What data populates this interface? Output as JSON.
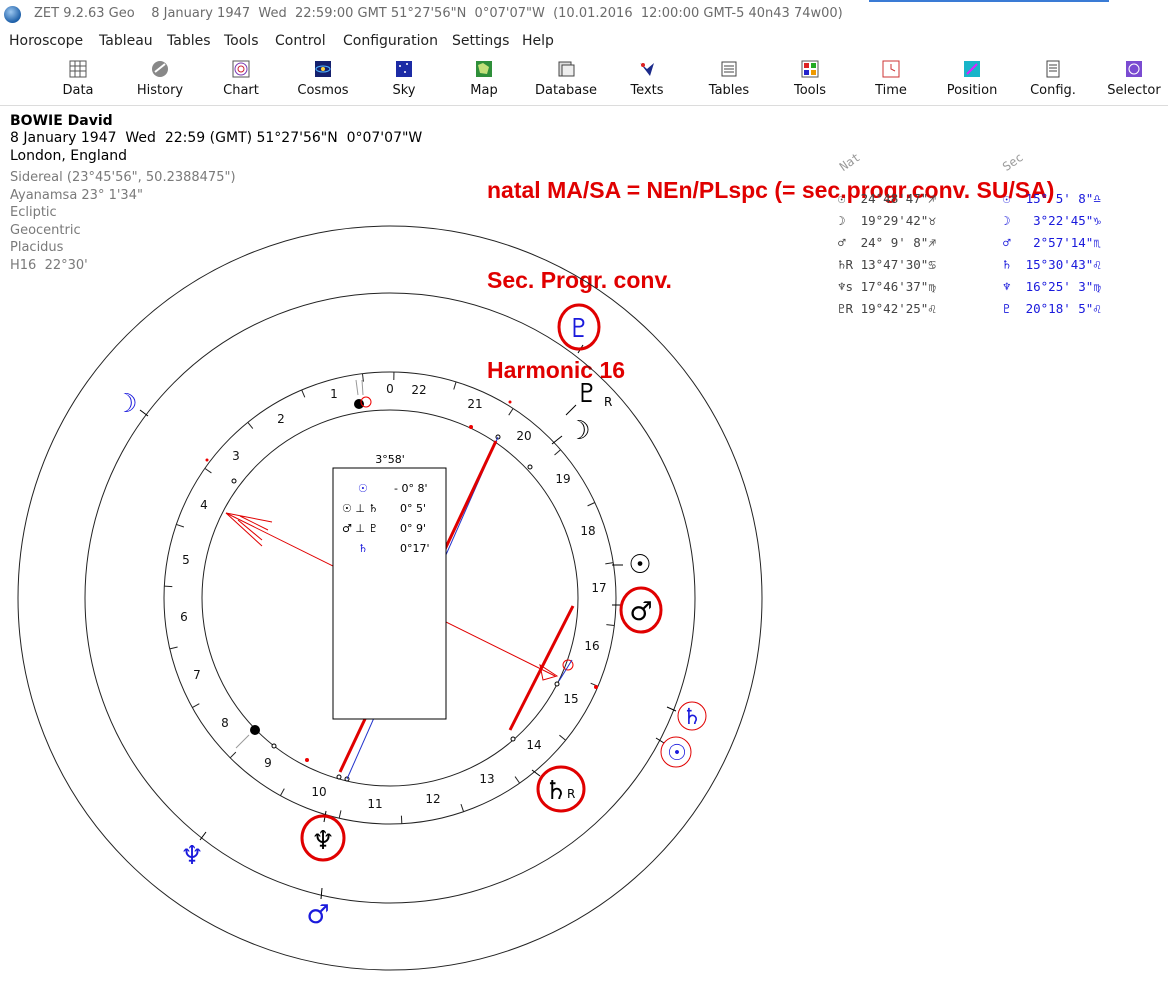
{
  "window": {
    "title": "ZET 9.2.63 Geo    8 January 1947  Wed  22:59:00 GMT 51°27'56\"N  0°07'07\"W  (10.01.2016  12:00:00 GMT-5 40n43 74w00)"
  },
  "menu": [
    "Horoscope",
    "Tableau",
    "Tables",
    "Tools",
    "Control",
    "Configuration",
    "Settings",
    "Help"
  ],
  "toolbar": [
    {
      "label": "Data",
      "icon": "data-grid-icon"
    },
    {
      "label": "History",
      "icon": "history-globe-icon"
    },
    {
      "label": "Chart",
      "icon": "chart-wheel-icon"
    },
    {
      "label": "Cosmos",
      "icon": "cosmos-icon"
    },
    {
      "label": "Sky",
      "icon": "sky-icon"
    },
    {
      "label": "Map",
      "icon": "map-icon"
    },
    {
      "label": "Database",
      "icon": "database-icon"
    },
    {
      "label": "Texts",
      "icon": "texts-icon"
    },
    {
      "label": "Tables",
      "icon": "tables-icon"
    },
    {
      "label": "Tools",
      "icon": "tools-icon"
    },
    {
      "label": "Time",
      "icon": "time-icon"
    },
    {
      "label": "Position",
      "icon": "position-icon"
    },
    {
      "label": "Config.",
      "icon": "config-icon"
    },
    {
      "label": "Selector",
      "icon": "selector-icon"
    }
  ],
  "person": {
    "name": "BOWIE David",
    "date_line": "8 January 1947  Wed  22:59 (GMT) 51°27'56\"N  0°07'07\"W",
    "place": "London, England",
    "settings": [
      "Sidereal (23°45'56\", 50.2388475\")",
      "Ayanamsa 23° 1'34\"",
      "Ecliptic",
      "Geocentric",
      "Placidus",
      "H16  22°30'"
    ]
  },
  "annotation": {
    "line1": "natal MA/SA = NEn/PLspc (= sec.progr.conv. SU/SA)",
    "line2": "Sec. Progr. conv.",
    "line3": "Harmonic 16"
  },
  "positions": {
    "natal_header": "Nat",
    "sec_header": "Sec",
    "natal": [
      {
        "glyph": "☉",
        "value": "24°48'47\"",
        "sign": "♐"
      },
      {
        "glyph": "☽",
        "value": "19°29'42\"",
        "sign": "♉"
      },
      {
        "glyph": "♂",
        "value": "24° 9' 8\"",
        "sign": "♐"
      },
      {
        "glyph": "♄R",
        "value": "13°47'30\"",
        "sign": "♋"
      },
      {
        "glyph": "♆s",
        "value": "17°46'37\"",
        "sign": "♍"
      },
      {
        "glyph": "♇R",
        "value": "19°42'25\"",
        "sign": "♌"
      }
    ],
    "sec": [
      {
        "glyph": "☉",
        "value": "15° 5' 8\"",
        "sign": "♎"
      },
      {
        "glyph": "☽",
        "value": " 3°22'45\"",
        "sign": "♑"
      },
      {
        "glyph": "♂",
        "value": " 2°57'14\"",
        "sign": "♏"
      },
      {
        "glyph": "♄",
        "value": "15°30'43\"",
        "sign": "♌"
      },
      {
        "glyph": "♆",
        "value": "16°25' 3\"",
        "sign": "♍"
      },
      {
        "glyph": "♇",
        "value": "20°18' 5\"",
        "sign": "♌"
      }
    ]
  },
  "chart": {
    "ring_numbers": [
      "0",
      "1",
      "2",
      "3",
      "4",
      "5",
      "6",
      "7",
      "8",
      "9",
      "10",
      "11",
      "12",
      "13",
      "14",
      "15",
      "16",
      "17",
      "18",
      "19",
      "20",
      "21",
      "22"
    ],
    "box_title": "3°58'",
    "box_rows": [
      {
        "sym": "☉",
        "val": "- 0° 8'",
        "color": "#1a1adc"
      },
      {
        "sym": "☉ ⊥ ♄",
        "val": "0° 5'",
        "color": "#000000"
      },
      {
        "sym": "♂ ⊥ ♇",
        "val": "0° 9'",
        "color": "#000000"
      },
      {
        "sym": "♄",
        "val": "0°17'",
        "color": "#1a1adc"
      }
    ],
    "natal_planets": [
      {
        "glyph": "♇",
        "label": "R"
      },
      {
        "glyph": "☽",
        "label": ""
      },
      {
        "glyph": "☉",
        "label": ""
      },
      {
        "glyph": "♂",
        "label": ""
      },
      {
        "glyph": "♄",
        "label": "R"
      },
      {
        "glyph": "♆",
        "label": ""
      }
    ],
    "sec_planets": [
      {
        "glyph": "☽"
      },
      {
        "glyph": "♇"
      },
      {
        "glyph": "♄"
      },
      {
        "glyph": "☉"
      },
      {
        "glyph": "♆"
      },
      {
        "glyph": "♂"
      }
    ],
    "colors": {
      "natal": "#000000",
      "sec": "#1a1adc",
      "highlight": "#e00000"
    }
  }
}
